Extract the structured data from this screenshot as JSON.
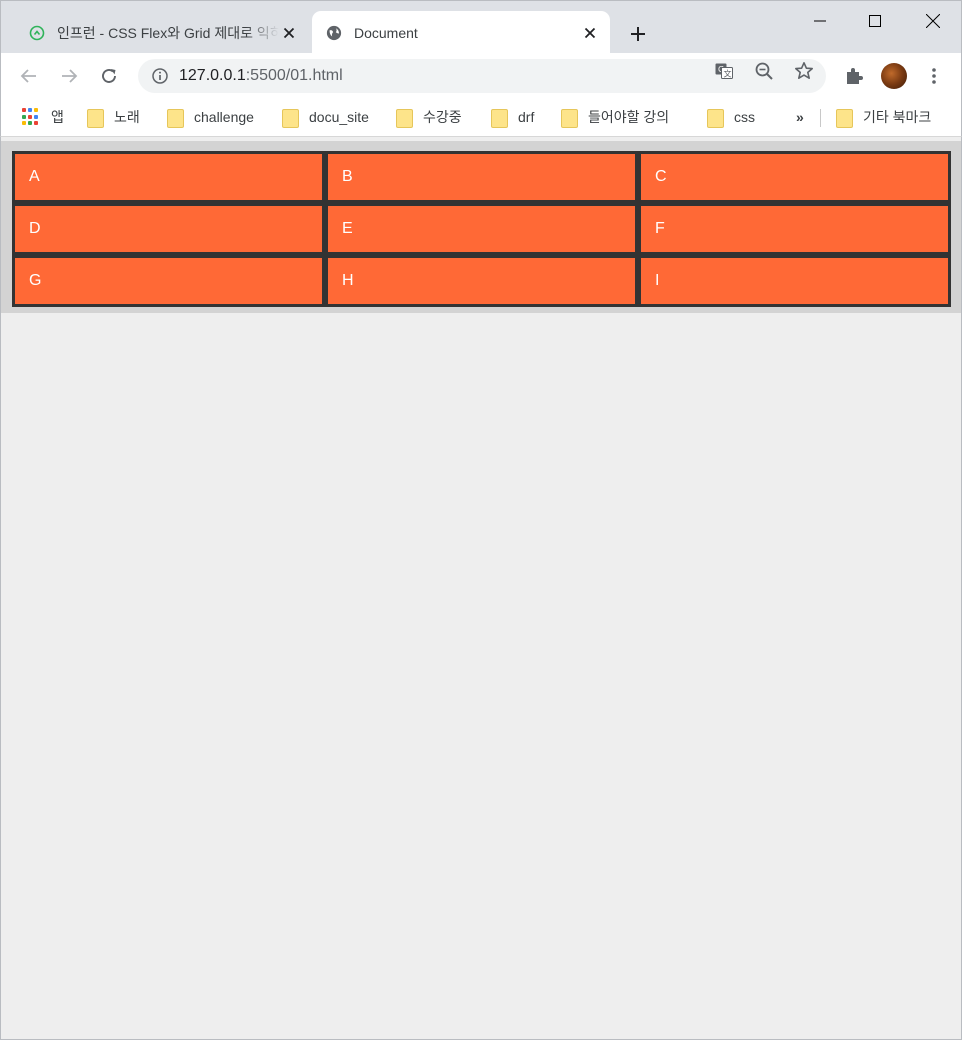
{
  "browser": {
    "tabs": [
      {
        "title": "인프런 - CSS Flex와 Grid 제대로 익히기",
        "active": false,
        "favicon": "inflearn-favicon"
      },
      {
        "title": "Document",
        "active": true,
        "favicon": "globe-icon"
      }
    ],
    "new_tab_label": "+",
    "url_host": "127.0.0.1",
    "url_rest": ":5500/01.html"
  },
  "bookmarks": {
    "apps_label": "앱",
    "items": [
      "노래",
      "challenge",
      "docu_site",
      "수강중",
      "drf",
      "들어야할 강의",
      "css"
    ],
    "more_label": "»",
    "other_label": "기타 북마크"
  },
  "grid_items": [
    "A",
    "B",
    "C",
    "D",
    "E",
    "F",
    "G",
    "H",
    "I"
  ],
  "colors": {
    "item_bg": "#ff6936",
    "item_border": "#333333",
    "container_bg": "#d3d3d3",
    "page_bg": "#eeeeee"
  }
}
